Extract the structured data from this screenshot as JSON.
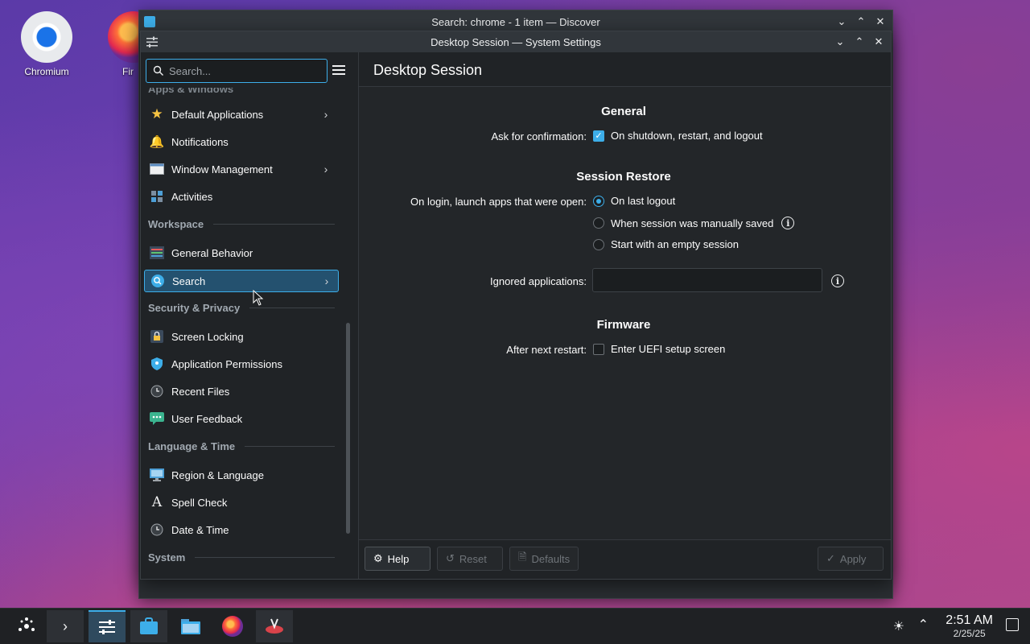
{
  "desktop": {
    "icons": [
      {
        "label": "Chromium",
        "icon": "chromium-icon"
      },
      {
        "label": "Fir",
        "icon": "firefox-icon"
      }
    ]
  },
  "discover_window": {
    "title": "Search: chrome - 1 item — Discover"
  },
  "settings_window": {
    "title": "Desktop Session — System Settings",
    "search_placeholder": "Search...",
    "page_title": "Desktop Session",
    "sidebar": {
      "partial_category": "Apps & Windows",
      "apps_items": [
        {
          "label": "Default Applications",
          "icon": "star-icon",
          "has_children": true
        },
        {
          "label": "Notifications",
          "icon": "bell-icon",
          "has_children": false
        },
        {
          "label": "Window Management",
          "icon": "window-icon",
          "has_children": true
        },
        {
          "label": "Activities",
          "icon": "activities-icon",
          "has_children": false
        }
      ],
      "cat_workspace": "Workspace",
      "workspace_items": [
        {
          "label": "General Behavior",
          "icon": "general-behavior-icon",
          "has_children": false
        },
        {
          "label": "Search",
          "icon": "search-icon",
          "has_children": true,
          "selected": true
        }
      ],
      "cat_security": "Security & Privacy",
      "security_items": [
        {
          "label": "Screen Locking",
          "icon": "lock-icon"
        },
        {
          "label": "Application Permissions",
          "icon": "shield-icon"
        },
        {
          "label": "Recent Files",
          "icon": "clock-icon"
        },
        {
          "label": "User Feedback",
          "icon": "feedback-icon"
        }
      ],
      "cat_language": "Language & Time",
      "language_items": [
        {
          "label": "Region & Language",
          "icon": "region-icon"
        },
        {
          "label": "Spell Check",
          "icon": "spellcheck-icon"
        },
        {
          "label": "Date & Time",
          "icon": "clock-icon"
        }
      ],
      "cat_system": "System"
    },
    "content": {
      "general_heading": "General",
      "ask_label": "Ask for confirmation:",
      "ask_option": "On shutdown, restart, and logout",
      "ask_checked": true,
      "restore_heading": "Session Restore",
      "restore_label": "On login, launch apps that were open:",
      "restore_options": [
        "On last logout",
        "When session was manually saved",
        "Start with an empty session"
      ],
      "restore_selected": 0,
      "ignored_label": "Ignored applications:",
      "ignored_value": "",
      "firmware_heading": "Firmware",
      "firmware_label": "After next restart:",
      "firmware_option": "Enter UEFI setup screen",
      "firmware_checked": false
    },
    "footer": {
      "help": "Help",
      "reset": "Reset",
      "defaults": "Defaults",
      "apply": "Apply"
    }
  },
  "taskbar": {
    "time": "2:51 AM",
    "date": "2/25/25",
    "apps": [
      "application-launcher-icon",
      "terminal-icon",
      "system-settings-icon",
      "discover-icon",
      "file-manager-icon",
      "firefox-icon",
      "ksnip-icon"
    ]
  }
}
